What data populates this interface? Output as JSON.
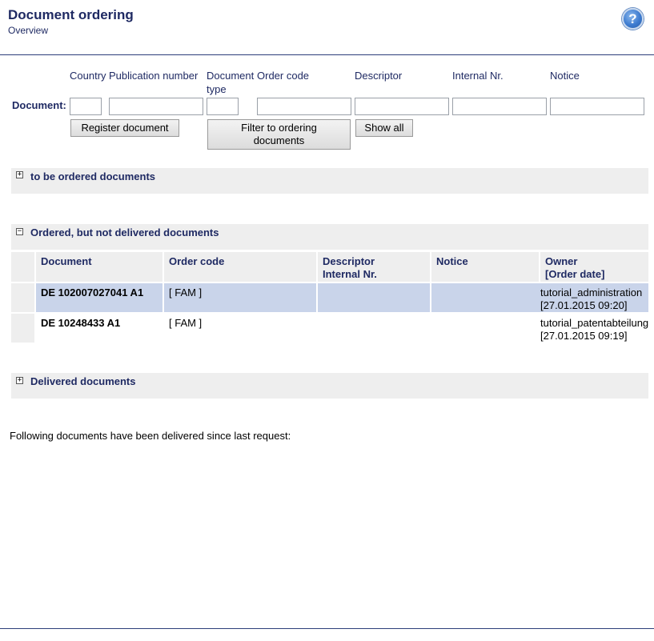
{
  "header": {
    "title": "Document ordering",
    "subtitle": "Overview",
    "help_icon": "?"
  },
  "form": {
    "columns": {
      "country": "Country",
      "publication_number": "Publication number",
      "document_type": "Document type",
      "order_code": "Order code",
      "descriptor": "Descriptor",
      "internal_nr": "Internal Nr.",
      "notice": "Notice"
    },
    "document_label": "Document:",
    "values": {
      "country": "",
      "publication_number": "",
      "document_type": "",
      "order_code": "",
      "descriptor": "",
      "internal_nr": "",
      "notice": ""
    },
    "buttons": {
      "register": "Register document",
      "filter": "Filter to ordering documents",
      "show_all": "Show all"
    }
  },
  "sections": {
    "to_be_ordered": {
      "title": "to be ordered documents",
      "toggle": "+"
    },
    "ordered_not_delivered": {
      "title": "Ordered, but not delivered documents",
      "toggle": "−"
    },
    "delivered": {
      "title": "Delivered documents",
      "toggle": "+"
    }
  },
  "ordered_table": {
    "headers": {
      "document": "Document",
      "order_code": "Order code",
      "descriptor": "Descriptor",
      "internal_nr": "Internal Nr.",
      "notice": "Notice",
      "owner": "Owner",
      "order_date": "[Order date]"
    },
    "rows": [
      {
        "document": "DE 102007027041 A1",
        "order_code": "[ FAM ]",
        "descriptor": "",
        "notice": "",
        "owner": "tutorial_administration",
        "order_date": "[27.01.2015 09:20]",
        "selected": true
      },
      {
        "document": "DE 10248433 A1",
        "order_code": "[ FAM ]",
        "descriptor": "",
        "notice": "",
        "owner": "tutorial_patentabteilung",
        "order_date": "[27.01.2015 09:19]",
        "selected": false
      }
    ]
  },
  "footer": {
    "delivered_message": "Following documents have been delivered since last request:"
  }
}
